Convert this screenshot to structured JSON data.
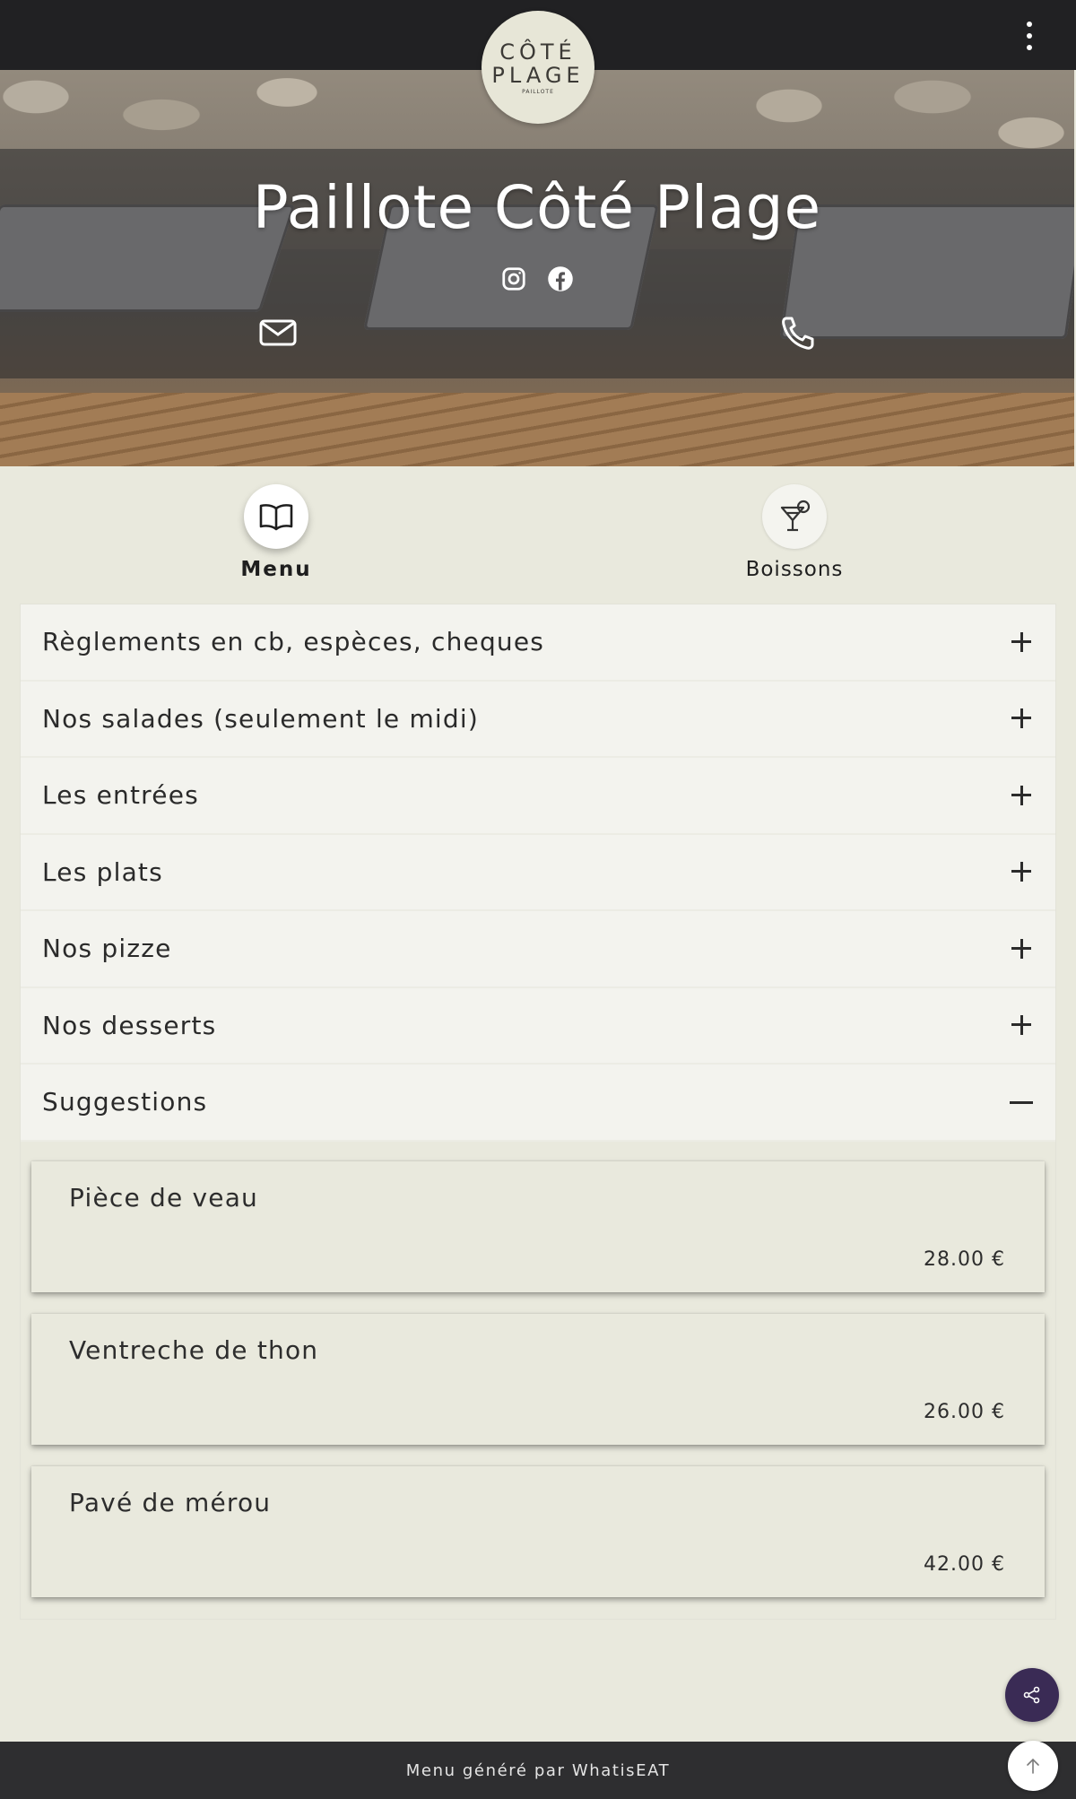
{
  "header": {
    "logo": {
      "line1": "CÔTÉ",
      "line2": "PLAGE",
      "line3": "PAILLOTE"
    },
    "menu_icon": "more-vertical-icon"
  },
  "hero": {
    "title": "Paillote Côté Plage",
    "social_icons": [
      "instagram-icon",
      "facebook-icon"
    ],
    "contact_icons": [
      "envelope-icon",
      "phone-icon"
    ]
  },
  "tabs": [
    {
      "label": "Menu",
      "icon": "book-icon",
      "active": true
    },
    {
      "label": "Boissons",
      "icon": "cocktail-icon",
      "active": false
    }
  ],
  "sections": [
    {
      "label": "Règlements en cb, espèces, cheques",
      "expanded": false
    },
    {
      "label": "Nos salades (seulement le midi)",
      "expanded": false
    },
    {
      "label": "Les entrées",
      "expanded": false
    },
    {
      "label": "Les plats",
      "expanded": false
    },
    {
      "label": "Nos pizze",
      "expanded": false
    },
    {
      "label": "Nos desserts",
      "expanded": false
    },
    {
      "label": "Suggestions",
      "expanded": true
    }
  ],
  "suggestions": [
    {
      "name": "Pièce de veau",
      "price": "28.00 €"
    },
    {
      "name": "Ventreche de thon",
      "price": "26.00 €"
    },
    {
      "name": "Pavé de mérou",
      "price": "42.00 €"
    }
  ],
  "footer": {
    "text": "Menu généré par WhatisEAT"
  },
  "floating": {
    "share_icon": "share-icon",
    "top_icon": "arrow-up-icon"
  },
  "colors": {
    "topbar": "#212123",
    "background": "#e9e9dd",
    "share_button": "#3a2b55",
    "footer": "#2e2e30"
  }
}
